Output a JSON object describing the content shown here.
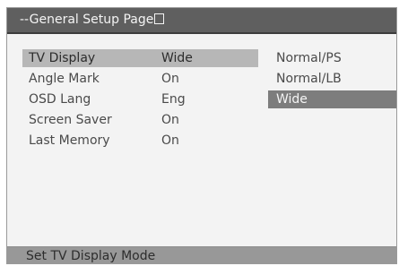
{
  "page": {
    "title": "--General Setup Page",
    "title_icon": "square-outline-icon",
    "status_text": "Set TV Display Mode"
  },
  "settings": [
    {
      "label": "TV Display",
      "value": "Wide"
    },
    {
      "label": "Angle Mark",
      "value": "On"
    },
    {
      "label": "OSD Lang",
      "value": "Eng"
    },
    {
      "label": "Screen Saver",
      "value": "On"
    },
    {
      "label": "Last Memory",
      "value": "On"
    }
  ],
  "options": [
    {
      "label": "Normal/PS"
    },
    {
      "label": "Normal/LB"
    },
    {
      "label": "Wide"
    }
  ],
  "selection": {
    "setting_index": 0,
    "option_index": 2
  },
  "colors": {
    "title_bar": "#5f5f5f",
    "content_bg": "#f3f3f3",
    "selected_setting": "#b7b7b7",
    "selected_option": "#7d7d7d",
    "status_bar": "#989898"
  }
}
